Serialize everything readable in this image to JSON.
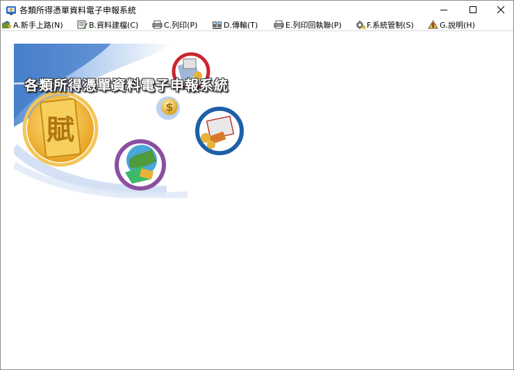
{
  "window": {
    "title": "各類所得憑單資料電子申報系統"
  },
  "menu": [
    {
      "label": "A.新手上路(N)",
      "icon": "new-user-icon"
    },
    {
      "label": "B.資料建檔(C)",
      "icon": "data-entry-icon"
    },
    {
      "label": "C.列印(P)",
      "icon": "printer-icon"
    },
    {
      "label": "D.傳輸(T)",
      "icon": "transfer-icon"
    },
    {
      "label": "E.列印回執聯(P)",
      "icon": "receipt-printer-icon"
    },
    {
      "label": "F.系統管制(S)",
      "icon": "system-control-icon"
    },
    {
      "label": "G.說明(H)",
      "icon": "help-icon"
    }
  ],
  "banner": {
    "title": "各類所得憑單資料電子申報系統",
    "emblem_char": "賦"
  },
  "colors": {
    "banner_blue": "#3f78c7",
    "gold": "#e8b23a",
    "ring_red": "#c9262f",
    "ring_blue": "#1f5fa8",
    "ring_purple": "#8c4fa0"
  }
}
